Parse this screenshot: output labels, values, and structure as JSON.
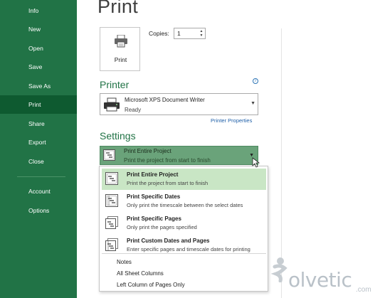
{
  "sidebar": {
    "items": [
      {
        "label": "Info"
      },
      {
        "label": "New"
      },
      {
        "label": "Open"
      },
      {
        "label": "Save"
      },
      {
        "label": "Save As"
      },
      {
        "label": "Print",
        "active": true
      },
      {
        "label": "Share"
      },
      {
        "label": "Export"
      },
      {
        "label": "Close"
      },
      {
        "label": "Account"
      },
      {
        "label": "Options"
      }
    ],
    "bg_color": "#217346"
  },
  "main": {
    "title": "Print",
    "print_button_label": "Print",
    "copies_label": "Copies:",
    "copies_value": "1"
  },
  "printer": {
    "section_title": "Printer",
    "name": "Microsoft XPS Document Writer",
    "status": "Ready",
    "properties_link": "Printer Properties",
    "info_icon": "info-icon"
  },
  "settings": {
    "section_title": "Settings",
    "selected_title": "Print Entire Project",
    "selected_subtitle": "Print the project from start to finish",
    "accent_color": "#6aa37a"
  },
  "dropdown": {
    "options": [
      {
        "title": "Print Entire Project",
        "subtitle": "Print the project from start to finish",
        "selected": true
      },
      {
        "title": "Print Specific Dates",
        "subtitle": "Only print the timescale between the select dates"
      },
      {
        "title": "Print Specific Pages",
        "subtitle": "Only print the pages specified"
      },
      {
        "title": "Print Custom Dates and Pages",
        "subtitle": "Enter specific pages and timescale dates for printing"
      }
    ],
    "extra_items": [
      {
        "label": "Notes"
      },
      {
        "label": "All Sheet Columns"
      },
      {
        "label": "Left Column of Pages Only"
      }
    ]
  },
  "watermark": {
    "text": "olvetic",
    "suffix": ".com"
  }
}
